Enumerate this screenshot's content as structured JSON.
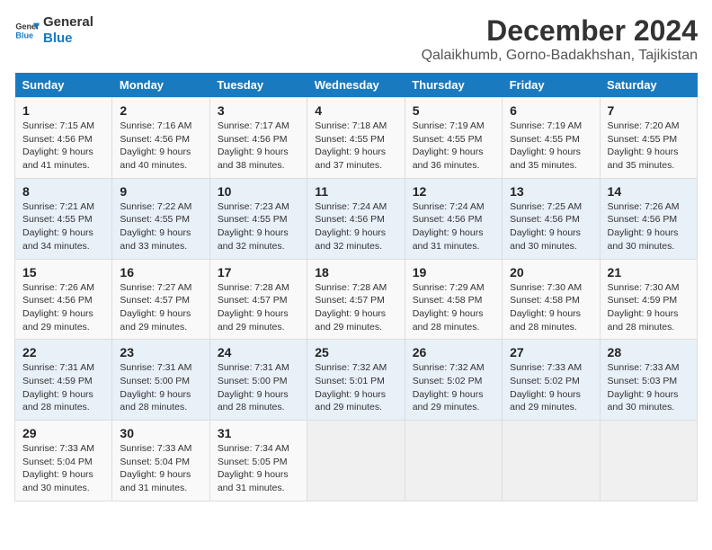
{
  "logo": {
    "line1": "General",
    "line2": "Blue"
  },
  "title": "December 2024",
  "subtitle": "Qalaikhumb, Gorno-Badakhshan, Tajikistan",
  "days_of_week": [
    "Sunday",
    "Monday",
    "Tuesday",
    "Wednesday",
    "Thursday",
    "Friday",
    "Saturday"
  ],
  "weeks": [
    [
      {
        "num": "1",
        "info": "Sunrise: 7:15 AM\nSunset: 4:56 PM\nDaylight: 9 hours and 41 minutes."
      },
      {
        "num": "2",
        "info": "Sunrise: 7:16 AM\nSunset: 4:56 PM\nDaylight: 9 hours and 40 minutes."
      },
      {
        "num": "3",
        "info": "Sunrise: 7:17 AM\nSunset: 4:56 PM\nDaylight: 9 hours and 38 minutes."
      },
      {
        "num": "4",
        "info": "Sunrise: 7:18 AM\nSunset: 4:55 PM\nDaylight: 9 hours and 37 minutes."
      },
      {
        "num": "5",
        "info": "Sunrise: 7:19 AM\nSunset: 4:55 PM\nDaylight: 9 hours and 36 minutes."
      },
      {
        "num": "6",
        "info": "Sunrise: 7:19 AM\nSunset: 4:55 PM\nDaylight: 9 hours and 35 minutes."
      },
      {
        "num": "7",
        "info": "Sunrise: 7:20 AM\nSunset: 4:55 PM\nDaylight: 9 hours and 35 minutes."
      }
    ],
    [
      {
        "num": "8",
        "info": "Sunrise: 7:21 AM\nSunset: 4:55 PM\nDaylight: 9 hours and 34 minutes."
      },
      {
        "num": "9",
        "info": "Sunrise: 7:22 AM\nSunset: 4:55 PM\nDaylight: 9 hours and 33 minutes."
      },
      {
        "num": "10",
        "info": "Sunrise: 7:23 AM\nSunset: 4:55 PM\nDaylight: 9 hours and 32 minutes."
      },
      {
        "num": "11",
        "info": "Sunrise: 7:24 AM\nSunset: 4:56 PM\nDaylight: 9 hours and 32 minutes."
      },
      {
        "num": "12",
        "info": "Sunrise: 7:24 AM\nSunset: 4:56 PM\nDaylight: 9 hours and 31 minutes."
      },
      {
        "num": "13",
        "info": "Sunrise: 7:25 AM\nSunset: 4:56 PM\nDaylight: 9 hours and 30 minutes."
      },
      {
        "num": "14",
        "info": "Sunrise: 7:26 AM\nSunset: 4:56 PM\nDaylight: 9 hours and 30 minutes."
      }
    ],
    [
      {
        "num": "15",
        "info": "Sunrise: 7:26 AM\nSunset: 4:56 PM\nDaylight: 9 hours and 29 minutes."
      },
      {
        "num": "16",
        "info": "Sunrise: 7:27 AM\nSunset: 4:57 PM\nDaylight: 9 hours and 29 minutes."
      },
      {
        "num": "17",
        "info": "Sunrise: 7:28 AM\nSunset: 4:57 PM\nDaylight: 9 hours and 29 minutes."
      },
      {
        "num": "18",
        "info": "Sunrise: 7:28 AM\nSunset: 4:57 PM\nDaylight: 9 hours and 29 minutes."
      },
      {
        "num": "19",
        "info": "Sunrise: 7:29 AM\nSunset: 4:58 PM\nDaylight: 9 hours and 28 minutes."
      },
      {
        "num": "20",
        "info": "Sunrise: 7:30 AM\nSunset: 4:58 PM\nDaylight: 9 hours and 28 minutes."
      },
      {
        "num": "21",
        "info": "Sunrise: 7:30 AM\nSunset: 4:59 PM\nDaylight: 9 hours and 28 minutes."
      }
    ],
    [
      {
        "num": "22",
        "info": "Sunrise: 7:31 AM\nSunset: 4:59 PM\nDaylight: 9 hours and 28 minutes."
      },
      {
        "num": "23",
        "info": "Sunrise: 7:31 AM\nSunset: 5:00 PM\nDaylight: 9 hours and 28 minutes."
      },
      {
        "num": "24",
        "info": "Sunrise: 7:31 AM\nSunset: 5:00 PM\nDaylight: 9 hours and 28 minutes."
      },
      {
        "num": "25",
        "info": "Sunrise: 7:32 AM\nSunset: 5:01 PM\nDaylight: 9 hours and 29 minutes."
      },
      {
        "num": "26",
        "info": "Sunrise: 7:32 AM\nSunset: 5:02 PM\nDaylight: 9 hours and 29 minutes."
      },
      {
        "num": "27",
        "info": "Sunrise: 7:33 AM\nSunset: 5:02 PM\nDaylight: 9 hours and 29 minutes."
      },
      {
        "num": "28",
        "info": "Sunrise: 7:33 AM\nSunset: 5:03 PM\nDaylight: 9 hours and 30 minutes."
      }
    ],
    [
      {
        "num": "29",
        "info": "Sunrise: 7:33 AM\nSunset: 5:04 PM\nDaylight: 9 hours and 30 minutes."
      },
      {
        "num": "30",
        "info": "Sunrise: 7:33 AM\nSunset: 5:04 PM\nDaylight: 9 hours and 31 minutes."
      },
      {
        "num": "31",
        "info": "Sunrise: 7:34 AM\nSunset: 5:05 PM\nDaylight: 9 hours and 31 minutes."
      },
      null,
      null,
      null,
      null
    ]
  ]
}
